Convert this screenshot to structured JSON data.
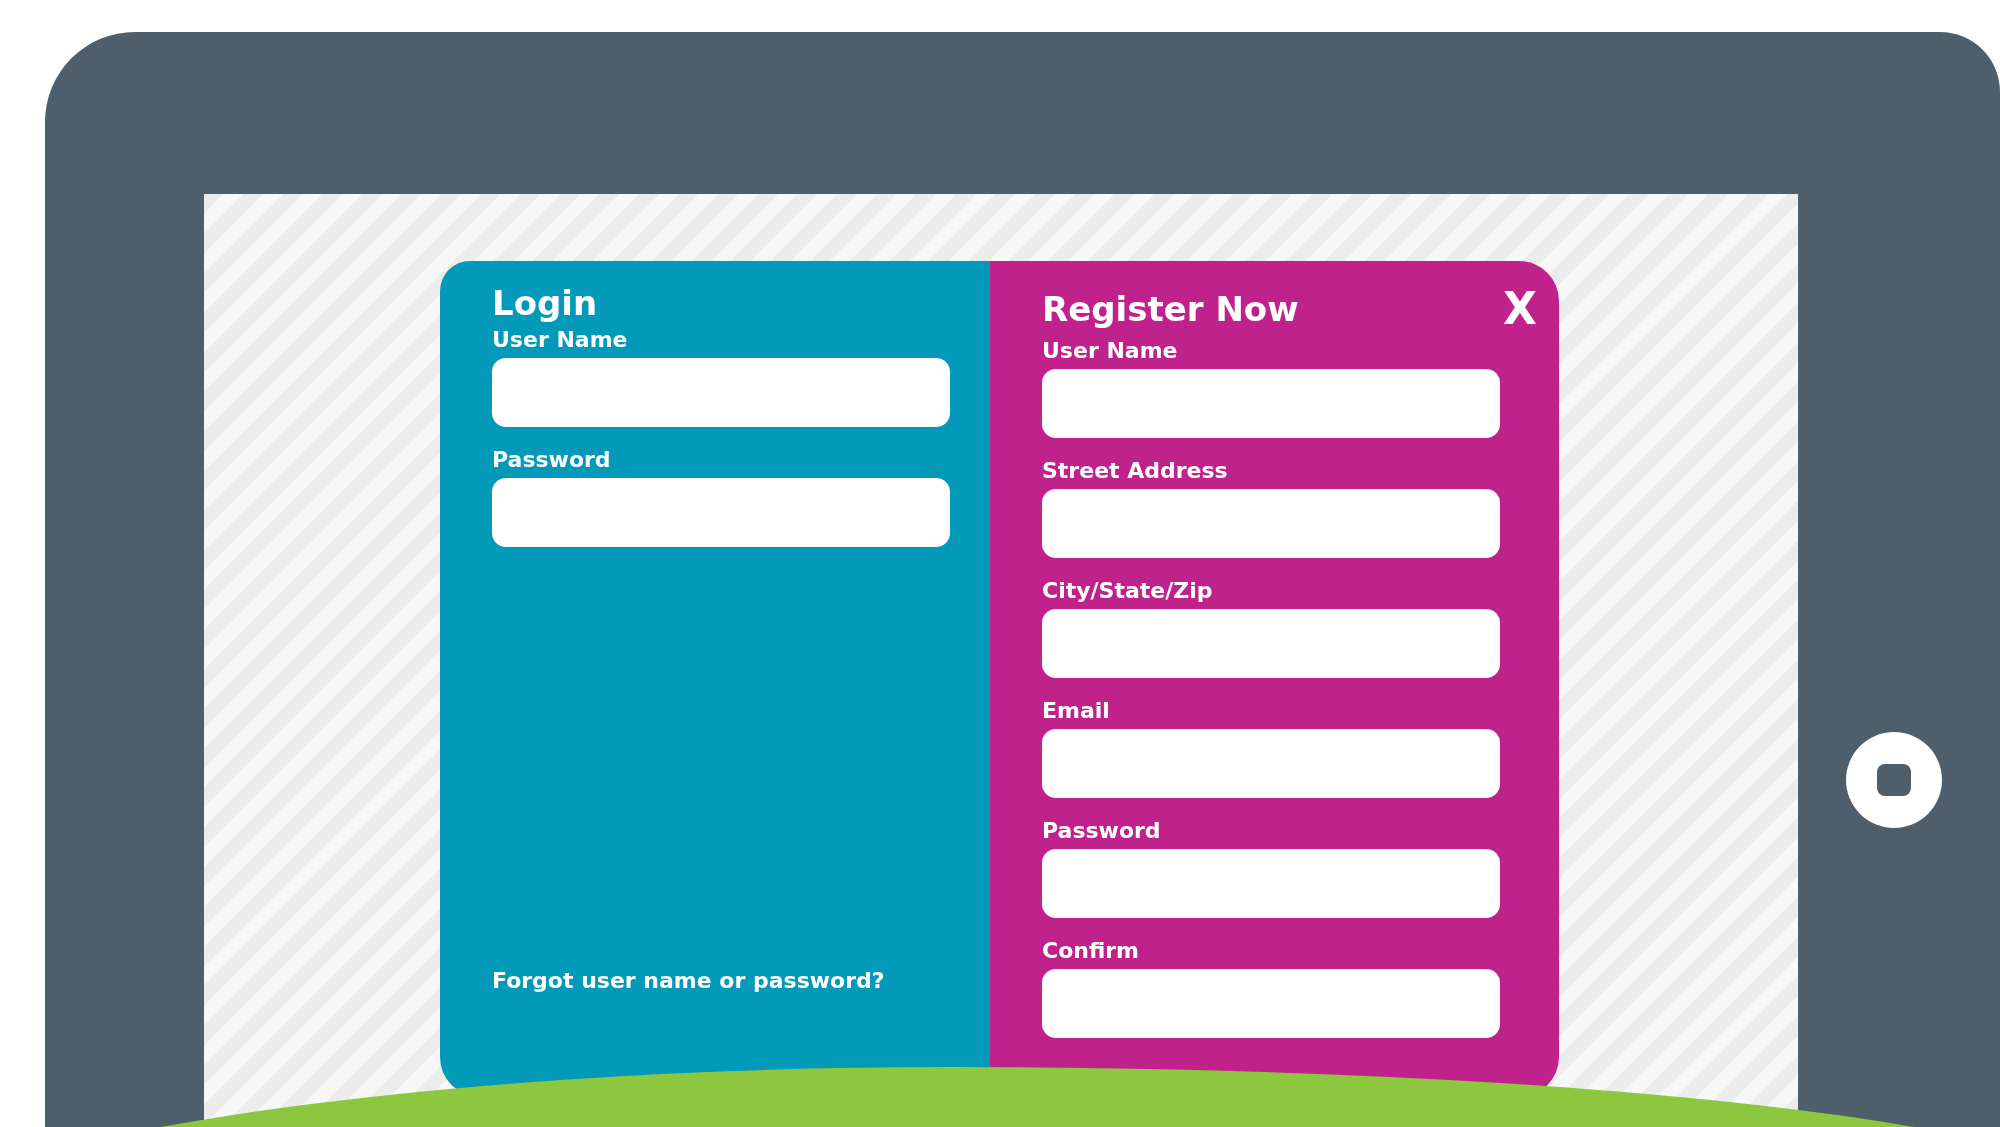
{
  "login": {
    "title": "Login",
    "fields": [
      {
        "label": "User Name"
      },
      {
        "label": "Password"
      }
    ],
    "link": "Forgot user name or password?"
  },
  "register": {
    "title": "Register Now",
    "close": "X",
    "fields": [
      {
        "label": "User Name"
      },
      {
        "label": "Street Address"
      },
      {
        "label": "City/State/Zip"
      },
      {
        "label": "Email"
      },
      {
        "label": "Password"
      },
      {
        "label": "Confirm"
      }
    ]
  }
}
